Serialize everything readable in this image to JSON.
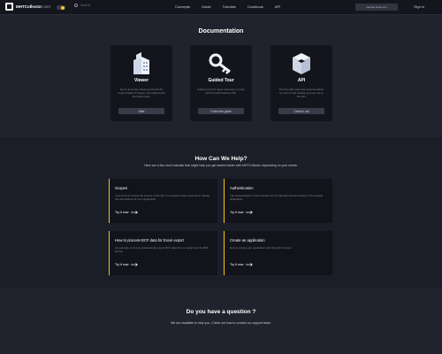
{
  "header": {
    "logo_text": "MHTCollector",
    "logo_suffix": ".com",
    "search_placeholder": "Search",
    "nav": [
      "Concepts",
      "Guide",
      "Tutorials",
      "Cookbook",
      "API"
    ],
    "button_label": "sample.tools.com",
    "sign_in": "Sign in"
  },
  "documentation": {
    "title": "Documentation",
    "separator": "···",
    "cards": [
      {
        "title": "Viewer",
        "desc": "Get to know the Viewer and load the customizable UI Viewer. Get started with the data model.",
        "button": "Start"
      },
      {
        "title": "Guided Tour",
        "desc": "Follow your first steps and begin to work with the MHTCollector API.",
        "button": "Follow the guide"
      },
      {
        "title": "API",
        "desc": "Find the API reference documentation for each of the classes you can use in the API.",
        "button": "Check it out"
      }
    ]
  },
  "help": {
    "title": "How Can We Help?",
    "subtitle": "Here are a few short tutorials that might help you get started faster with MHTCollector depending on your needs.",
    "cards": [
      {
        "title": "Scopes",
        "desc": "Learn how to restrict the access of the API to a specific scope and how to handle the permissions of your application.",
        "link": "Try it now"
      },
      {
        "title": "Authentication",
        "desc": "The authentication is fully handled by the OpenID Connect library in the sample application.",
        "link": "Try it now"
      },
      {
        "title": "How to process BCF data for Excel export",
        "desc": "An example of how to automatically export BCF data from a model and the BCF format.",
        "link": "Try it now"
      },
      {
        "title": "Create an application",
        "desc": "How to create your application and OpenID Connect.",
        "link": "Try it now"
      }
    ]
  },
  "question": {
    "title": "Do you have a question ?",
    "subtitle": "We are available to help you. Check out how to contact our support team."
  },
  "colors": {
    "accent": "#f5c518",
    "background": "#20222d",
    "card": "#14151c"
  }
}
